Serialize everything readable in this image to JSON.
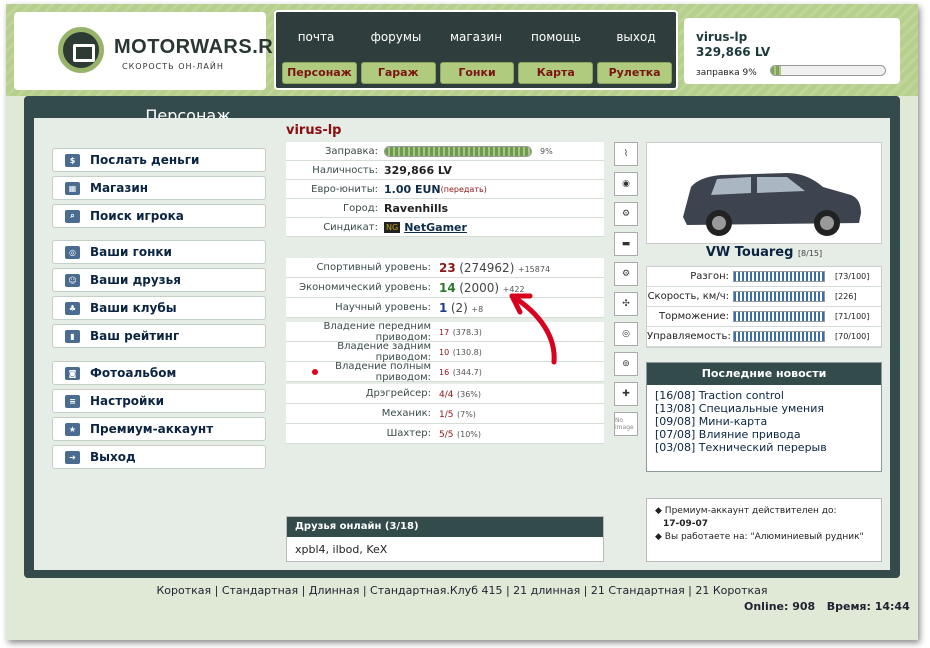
{
  "logo": {
    "title": "MOTORWARS.RU",
    "subtitle": "СКОРОСТЬ ОН-ЛАЙН"
  },
  "topnav": {
    "row1": [
      "почта",
      "форумы",
      "магазин",
      "помощь",
      "выход"
    ],
    "row2": [
      "Персонаж",
      "Гараж",
      "Гонки",
      "Карта",
      "Рулетка"
    ]
  },
  "user": {
    "name": "virus-lp",
    "balance": "329,866 LV",
    "fuel_label": "заправка 9%",
    "fuel_pct": 9
  },
  "section_title": "Персонаж",
  "menu": [
    {
      "label": "Послать деньги",
      "icon": "money-icon"
    },
    {
      "label": "Магазин",
      "icon": "shop-icon"
    },
    {
      "label": "Поиск игрока",
      "icon": "search-icon"
    },
    {
      "label": "Ваши гонки",
      "icon": "wheel-icon"
    },
    {
      "label": "Ваши друзья",
      "icon": "friends-icon"
    },
    {
      "label": "Ваши клубы",
      "icon": "clubs-icon"
    },
    {
      "label": "Ваш рейтинг",
      "icon": "chart-icon"
    },
    {
      "label": "Фотоальбом",
      "icon": "camera-icon"
    },
    {
      "label": "Настройки",
      "icon": "settings-icon"
    },
    {
      "label": "Премиум-аккаунт",
      "icon": "premium-icon"
    },
    {
      "label": "Выход",
      "icon": "exit-icon"
    }
  ],
  "profile": {
    "name": "virus-lp",
    "rows": [
      {
        "k": "Заправка:",
        "v": "9%"
      },
      {
        "k": "Наличность:",
        "v": "329,866 LV"
      },
      {
        "k": "Евро-юниты:",
        "v": "1.00 EUN",
        "extra": "(передать)"
      },
      {
        "k": "Город:",
        "v": "Ravenhills"
      },
      {
        "k": "Синдикат:",
        "v": "NetGamer",
        "badge": "NG"
      }
    ],
    "levels": [
      {
        "k": "Спортивный уровень:",
        "n": "23",
        "p": "(274962)",
        "d": "+15874"
      },
      {
        "k": "Экономический уровень:",
        "n": "14",
        "p": "(2000)",
        "d": "+422"
      },
      {
        "k": "Научный уровень:",
        "n": "1",
        "p": "(2)",
        "d": "+8"
      }
    ],
    "drive": [
      {
        "k": "Владение передним приводом:",
        "n": "17",
        "p": "(378.3)"
      },
      {
        "k": "Владение задним приводом:",
        "n": "10",
        "p": "(130.8)"
      },
      {
        "k": "Владение полным приводом:",
        "n": "16",
        "p": "(344.7)"
      }
    ],
    "jobs": [
      {
        "k": "Дрэгрейсер:",
        "n": "4/4",
        "p": "(36%)"
      },
      {
        "k": "Механик:",
        "n": "1/5",
        "p": "(7%)"
      },
      {
        "k": "Шахтер:",
        "n": "5/5",
        "p": "(10%)"
      }
    ]
  },
  "car": {
    "name": "VW Touareg",
    "idx": "[8/15]",
    "stats": [
      {
        "k": "Разгон:",
        "v": "[73/100]"
      },
      {
        "k": "Скорость, км/ч:",
        "v": "[226]"
      },
      {
        "k": "Торможение:",
        "v": "[71/100]"
      },
      {
        "k": "Управляемость:",
        "v": "[70/100]"
      }
    ]
  },
  "news": {
    "title": "Последние новости",
    "items": [
      "[16/08] Traction control",
      "[13/08] Специальные умения",
      "[09/08] Мини-карта",
      "[07/08] Влияние привода",
      "[03/08] Технический перерыв"
    ]
  },
  "premium": {
    "line1": "Премиум-аккаунт действителен до:",
    "date": "17-09-07",
    "line2": "Вы работаете на: \"Алюминиевый рудник\""
  },
  "friends": {
    "title": "Друзья онлайн (3/18)",
    "list": "xpbl4, ilbod, KeX"
  },
  "footer": {
    "links": "Короткая | Стандартная | Длинная | Стандартная.Клуб 415 | 21 длинная | 21 Стандартная | 21 Короткая",
    "online": "Online: 908",
    "time": "Время: 14:44"
  },
  "part_icon_no_image": "No image"
}
